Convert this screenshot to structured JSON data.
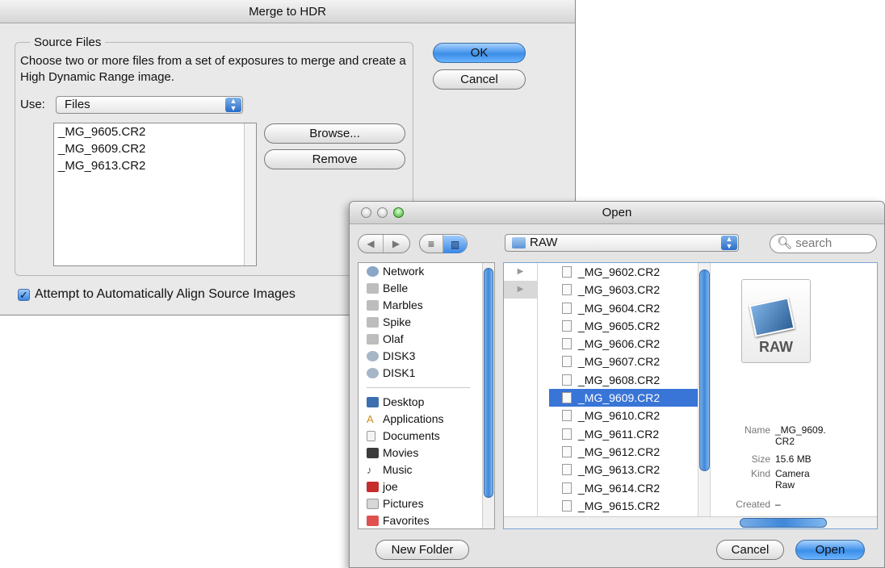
{
  "hdr": {
    "title": "Merge to HDR",
    "group_label": "Source Files",
    "instructions": "Choose two or more files from a set of exposures to merge and create a High Dynamic Range image.",
    "use_label": "Use:",
    "use_value": "Files",
    "files": [
      "_MG_9605.CR2",
      "_MG_9609.CR2",
      "_MG_9613.CR2"
    ],
    "browse_label": "Browse...",
    "remove_label": "Remove",
    "ok_label": "OK",
    "cancel_label": "Cancel",
    "align_label": "Attempt to Automatically Align Source Images",
    "align_checked": true
  },
  "open": {
    "title": "Open",
    "location": "RAW",
    "search_placeholder": "search",
    "sidebar_devices": [
      {
        "label": "Network",
        "icon": "network-icon"
      },
      {
        "label": "Belle",
        "icon": "computer-icon"
      },
      {
        "label": "Marbles",
        "icon": "computer-icon"
      },
      {
        "label": "Spike",
        "icon": "computer-icon"
      },
      {
        "label": "Olaf",
        "icon": "computer-icon"
      },
      {
        "label": "DISK3",
        "icon": "disk-icon"
      },
      {
        "label": "DISK1",
        "icon": "disk-icon"
      }
    ],
    "sidebar_places": [
      {
        "label": "Desktop",
        "icon": "desktop-icon"
      },
      {
        "label": "Applications",
        "icon": "applications-icon"
      },
      {
        "label": "Documents",
        "icon": "documents-icon"
      },
      {
        "label": "Movies",
        "icon": "movies-icon"
      },
      {
        "label": "Music",
        "icon": "music-icon"
      },
      {
        "label": "joe",
        "icon": "home-icon"
      },
      {
        "label": "Pictures",
        "icon": "pictures-icon"
      },
      {
        "label": "Favorites",
        "icon": "favorites-icon"
      }
    ],
    "files": [
      "_MG_9602.CR2",
      "_MG_9603.CR2",
      "_MG_9604.CR2",
      "_MG_9605.CR2",
      "_MG_9606.CR2",
      "_MG_9607.CR2",
      "_MG_9608.CR2",
      "_MG_9609.CR2",
      "_MG_9610.CR2",
      "_MG_9611.CR2",
      "_MG_9612.CR2",
      "_MG_9613.CR2",
      "_MG_9614.CR2",
      "_MG_9615.CR2"
    ],
    "selected_file": "_MG_9609.CR2",
    "preview_badge": "RAW",
    "meta": {
      "name_key": "Name",
      "name_val_1": "_MG_9609.",
      "name_val_2": "CR2",
      "size_key": "Size",
      "size_val": "15.6 MB",
      "kind_key": "Kind",
      "kind_val_1": "Camera",
      "kind_val_2": "Raw",
      "created_key": "Created",
      "created_val": "–"
    },
    "new_folder_label": "New Folder",
    "cancel_label": "Cancel",
    "open_label": "Open"
  }
}
